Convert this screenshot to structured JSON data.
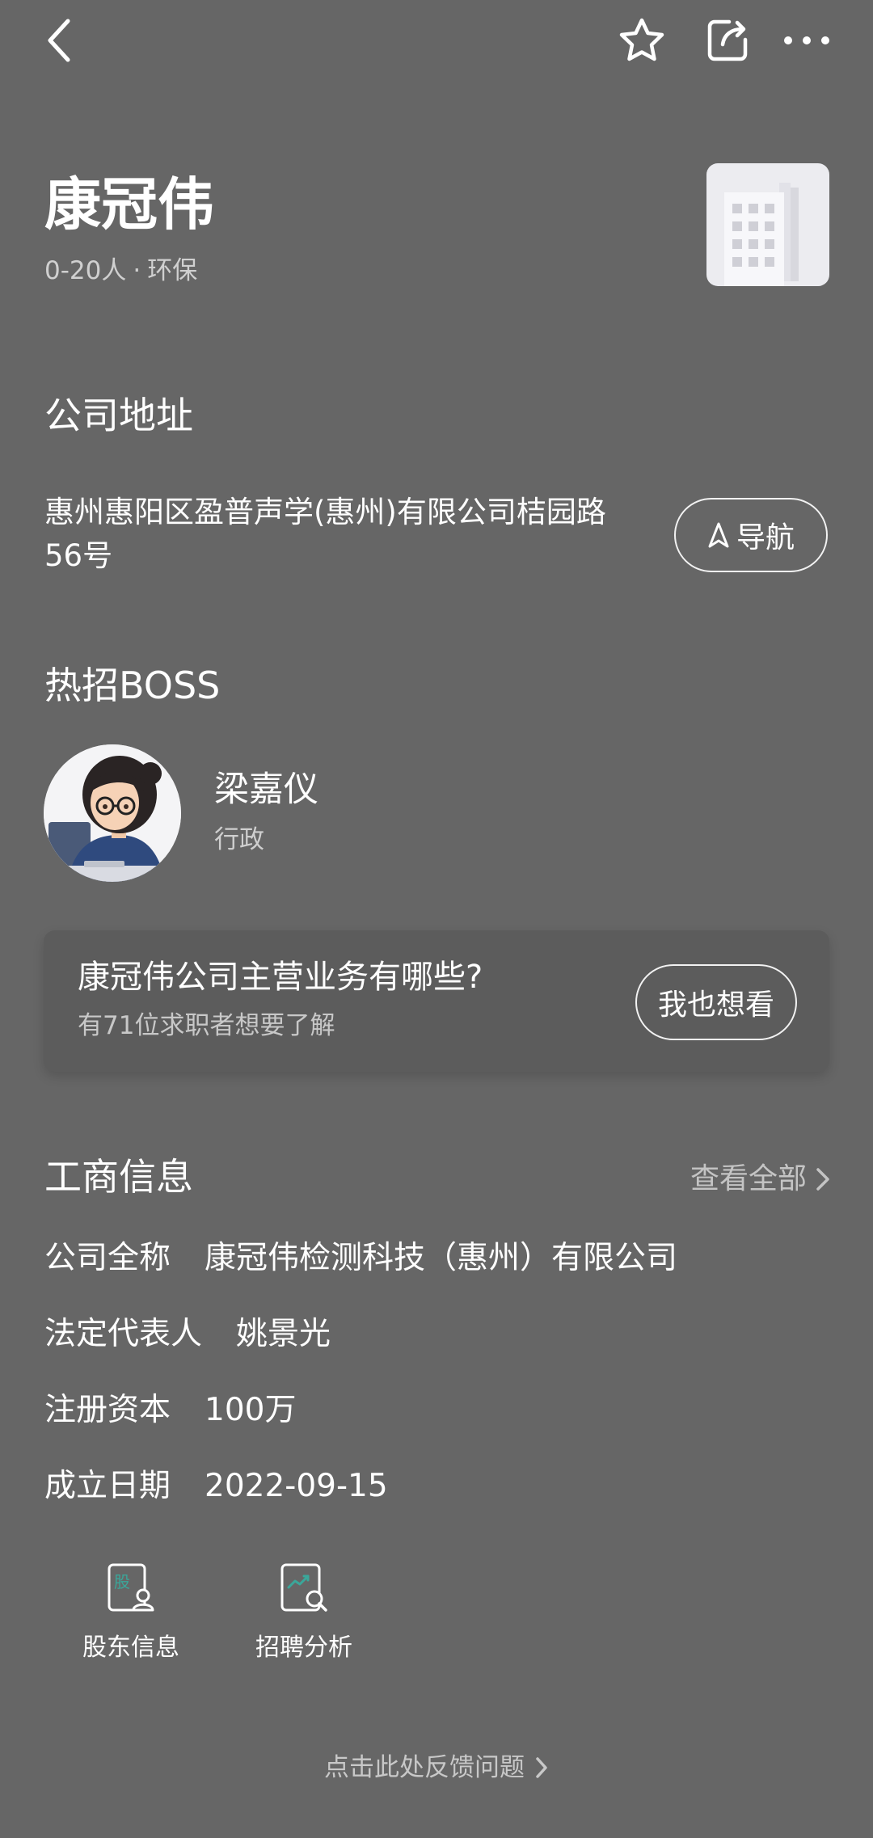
{
  "header": {
    "back_icon": "chevron-left-icon",
    "favorite_icon": "star-icon",
    "share_icon": "share-icon",
    "more_icon": "more-horizontal-icon"
  },
  "company": {
    "name": "康冠伟",
    "size": "0-20人",
    "separator": "·",
    "industry": "环保",
    "logo_icon": "building-icon"
  },
  "address": {
    "section_title": "公司地址",
    "text": "惠州惠阳区盈普声学(惠州)有限公司桔园路56号",
    "nav_button_label": "导航",
    "nav_icon": "navigation-arrow-icon"
  },
  "boss": {
    "section_title": "热招BOSS",
    "name": "梁嘉仪",
    "role": "行政"
  },
  "question_card": {
    "title": "康冠伟公司主营业务有哪些?",
    "subtitle": "有71位求职者想要了解",
    "button_label": "我也想看"
  },
  "business_info": {
    "section_title": "工商信息",
    "view_all_label": "查看全部",
    "rows": [
      {
        "label": "公司全称",
        "value": "康冠伟检测科技（惠州）有限公司"
      },
      {
        "label": "法定代表人",
        "value": "姚景光"
      },
      {
        "label": "注册资本",
        "value": "100万"
      },
      {
        "label": "成立日期",
        "value": "2022-09-15"
      }
    ]
  },
  "shortcuts": [
    {
      "label": "股东信息",
      "icon": "shareholder-icon",
      "icon_text": "股"
    },
    {
      "label": "招聘分析",
      "icon": "recruit-analysis-icon"
    }
  ],
  "feedback": {
    "label": "点击此处反馈问题"
  },
  "colors": {
    "background": "#666666",
    "card": "#5c5c5c",
    "accent_teal": "#3aa79a"
  }
}
